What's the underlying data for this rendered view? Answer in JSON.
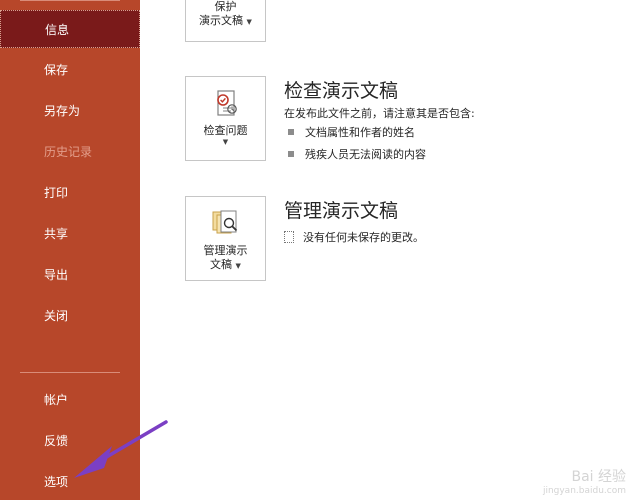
{
  "sidebar": {
    "items": [
      {
        "label": "信息",
        "state": "active"
      },
      {
        "label": "保存",
        "state": "normal"
      },
      {
        "label": "另存为",
        "state": "normal"
      },
      {
        "label": "历史记录",
        "state": "disabled"
      },
      {
        "label": "打印",
        "state": "normal"
      },
      {
        "label": "共享",
        "state": "normal"
      },
      {
        "label": "导出",
        "state": "normal"
      },
      {
        "label": "关闭",
        "state": "normal"
      }
    ],
    "bottom_items": [
      {
        "label": "帐户"
      },
      {
        "label": "反馈"
      },
      {
        "label": "选项"
      }
    ]
  },
  "protect": {
    "button_line1": "保护",
    "button_line2": "演示文稿"
  },
  "inspect": {
    "button_label": "检查问题",
    "title": "检查演示文稿",
    "desc": "在发布此文件之前，请注意其是否包含:",
    "bullets": [
      "文档属性和作者的姓名",
      "残疾人员无法阅读的内容"
    ]
  },
  "manage": {
    "button_line1": "管理演示",
    "button_line2": "文稿",
    "title": "管理演示文稿",
    "note": "没有任何未保存的更改。"
  },
  "watermark": {
    "line1": "Bai 经验",
    "line2": "jingyan.baidu.com"
  },
  "colors": {
    "sidebar_bg": "#b7472a",
    "sidebar_active": "#7a1a1a",
    "arrow": "#7b3fc4"
  }
}
